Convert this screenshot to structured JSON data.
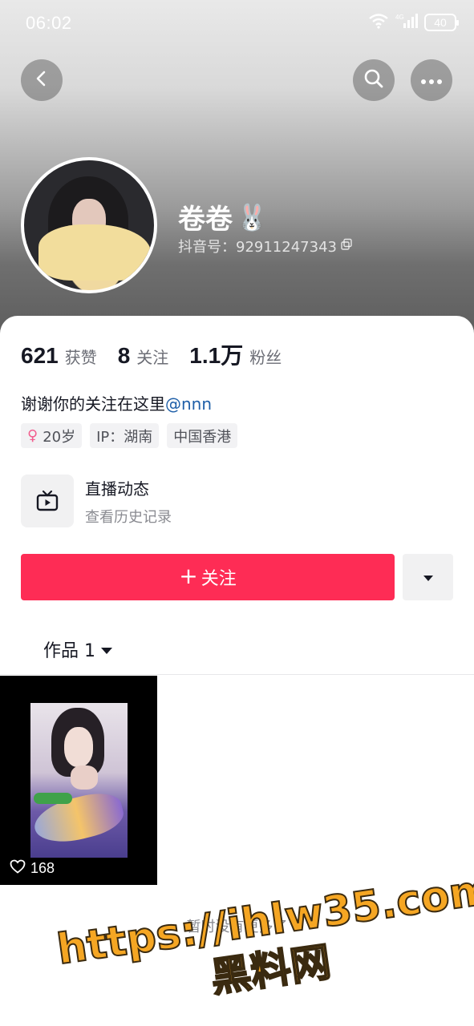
{
  "status_bar": {
    "time": "06:02",
    "battery": "40",
    "network_label": "4G"
  },
  "header": {
    "back_icon": "chevron-left-icon",
    "search_icon": "search-icon",
    "more_icon": "ellipsis-icon"
  },
  "profile": {
    "nickname": "卷卷",
    "nickname_emoji": "🐰",
    "douyin_id": "抖音号：92911247343",
    "copy_icon": "copy-icon"
  },
  "stats": [
    {
      "value": "621",
      "label": "获赞"
    },
    {
      "value": "8",
      "label": "关注"
    },
    {
      "value": "1.1万",
      "label": "粉丝"
    }
  ],
  "bio": {
    "text": "谢谢你的关注在这里",
    "mention": "@nnn"
  },
  "tags": {
    "gender_symbol": "♀",
    "age": "20岁",
    "ip": "IP：湖南",
    "region": "中国香港"
  },
  "live": {
    "title": "直播动态",
    "subtitle": "查看历史记录",
    "icon": "tv-icon"
  },
  "actions": {
    "follow_plus": "+",
    "follow_label": "关注",
    "dropdown_icon": "caret-down-icon"
  },
  "works": {
    "tab_label": "作品 1",
    "videos": [
      {
        "likes": "168"
      }
    ],
    "end_text": "暂时没有更多了"
  },
  "watermark": {
    "url": "https://ihlw35.com",
    "name": "黑料网"
  },
  "colors": {
    "accent": "#fe2c55",
    "mention": "#1f5fa8",
    "watermark": "#f5a623"
  }
}
